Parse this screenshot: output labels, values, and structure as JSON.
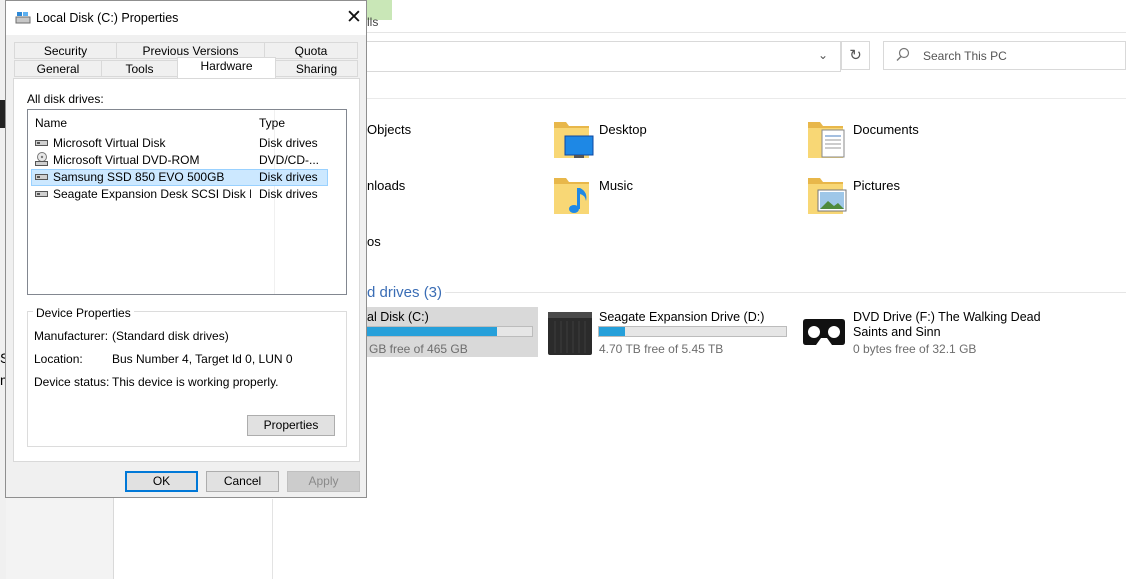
{
  "explorer": {
    "ribbon_tab": "lls",
    "search_placeholder": "Search This PC",
    "folders": [
      {
        "label": "Objects"
      },
      {
        "label": "Desktop"
      },
      {
        "label": "Documents"
      },
      {
        "label": "nloads"
      },
      {
        "label": "Music"
      },
      {
        "label": "Pictures"
      },
      {
        "label": "os"
      }
    ],
    "drives_heading": "d drives (3)",
    "drives": [
      {
        "name": "al Disk (C:)",
        "free": "GB free of 465 GB",
        "used_fraction": 0.8
      },
      {
        "name": "Seagate Expansion Drive (D:)",
        "free": "4.70 TB free of 5.45 TB",
        "used_fraction": 0.14
      },
      {
        "name": "DVD Drive (F:) The Walking Dead Saints and Sinn",
        "name_line1": "DVD Drive (F:) The Walking Dead",
        "name_line2": "Saints and Sinn",
        "free": "0 bytes free of 32.1 GB"
      }
    ],
    "left_partial": [
      "S",
      "m"
    ]
  },
  "dialog": {
    "title": "Local Disk (C:) Properties",
    "tabs_row1": [
      "Security",
      "Previous Versions",
      "Quota"
    ],
    "tabs_row2": [
      "General",
      "Tools",
      "Hardware",
      "Sharing"
    ],
    "selected_tab": "Hardware",
    "all_disk_drives_label": "All disk drives:",
    "columns": [
      "Name",
      "Type"
    ],
    "drives": [
      {
        "name": "Microsoft Virtual Disk",
        "type": "Disk drives",
        "icon": "disk-drive-icon"
      },
      {
        "name": "Microsoft Virtual DVD-ROM",
        "type": "DVD/CD-...",
        "icon": "dvd-drive-icon"
      },
      {
        "name": "Samsung SSD 850 EVO 500GB",
        "type": "Disk drives",
        "icon": "disk-drive-icon",
        "selected": true
      },
      {
        "name": "Seagate Expansion Desk SCSI Disk De...",
        "type": "Disk drives",
        "icon": "disk-drive-icon"
      }
    ],
    "device_properties": {
      "title": "Device Properties",
      "manufacturer_label": "Manufacturer:",
      "manufacturer": "(Standard disk drives)",
      "location_label": "Location:",
      "location": "Bus Number 4, Target Id 0, LUN 0",
      "status_label": "Device status:",
      "status": "This device is working properly.",
      "properties_button": "Properties"
    },
    "buttons": {
      "ok": "OK",
      "cancel": "Cancel",
      "apply": "Apply"
    }
  }
}
